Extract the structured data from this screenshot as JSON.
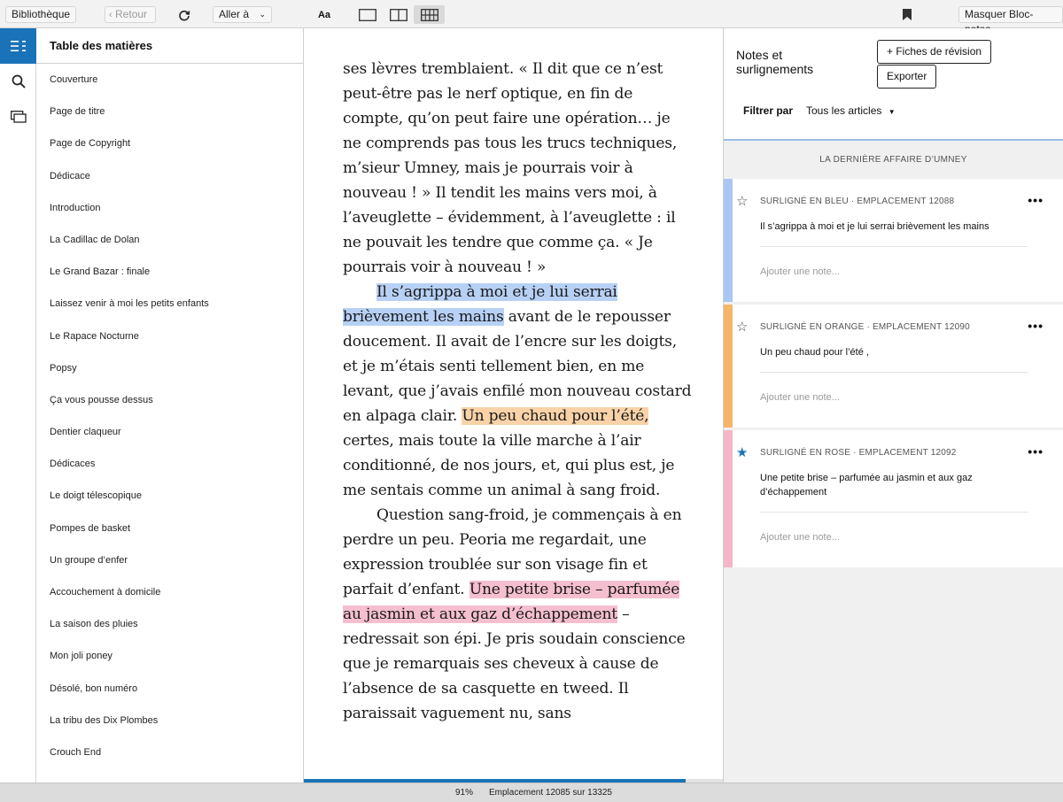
{
  "toolbar": {
    "library": "Bibliothèque",
    "back": "Retour",
    "goto": "Aller à",
    "font_button": "Aa",
    "hide_notebook": "Masquer Bloc-notes"
  },
  "toc": {
    "title": "Table des matières",
    "items": [
      "Couverture",
      "Page de titre",
      "Page de Copyright",
      "Dédicace",
      "Introduction",
      "La Cadillac de Dolan",
      "Le Grand Bazar : finale",
      "Laissez venir à moi les petits enfants",
      "Le Rapace Nocturne",
      "Popsy",
      "Ça vous pousse dessus",
      "Dentier claqueur",
      "Dédicaces",
      "Le doigt télescopique",
      "Pompes de basket",
      "Un groupe d’enfer",
      "Accouchement à domicile",
      "La saison des pluies",
      "Mon joli poney",
      "Désolé, bon numéro",
      "La tribu des Dix Plombes",
      "Crouch End"
    ]
  },
  "page": {
    "p1": "ses lèvres tremblaient. « Il dit que ce n’est peut-être pas le nerf optique, en fin de compte, qu’on peut faire une opération… je ne comprends pas tous les trucs tech­niques, m’sieur Umney, mais je pourrais voir à nouveau ! » Il tendit les mains vers moi, à l’aveuglette – évidemment, à l’aveu­glette : il ne pouvait les tendre que comme ça. « Je pourrais voir à nouveau ! »",
    "p2_hl_blue": "Il s’agrippa à moi et je lui serrai brièvement les mains",
    "p2_mid": " avant de le repous­ser doucement. Il avait de l’encre sur les doigts, et je m’étais senti tellement bien, en me levant, que j’avais enfilé mon nouveau costard en alpaga clair. ",
    "p2_hl_orange": "Un peu chaud pour l’été,",
    "p2_end": " certes, mais toute la ville marche à l’air conditionné, de nos jours, et, qui plus est, je me sentais comme un animal à sang froid.",
    "p3_start": "Question sang-froid, je commençais à en perdre un peu. Peoria me regardait, une expression troublée sur son visage fin et parfait d’enfant. ",
    "p3_hl_pink": "Une petite brise – parfumée au jasmin et aux gaz d’échappe­ment",
    "p3_end": " – redressait son épi. Je pris soudain conscience que je remarquais ses cheveux à cause de l’absence de sa casquette en tweed. Il paraissait vaguement nu, sans"
  },
  "notes": {
    "title": "Notes et surlignements",
    "flashcards_button": "+ Fiches de révision",
    "export_button": "Exporter",
    "filter_label": "Filtrer par",
    "filter_value": "Tous les articles",
    "book_title": "LA DERNIÈRE AFFAIRE D’UMNEY",
    "cards": [
      {
        "meta": "SURLIGNÉ EN BLEU · EMPLACEMENT 12088",
        "text": "Il s’agrippa à moi et je lui serrai brièvement les mains",
        "note_placeholder": "Ajouter une note...",
        "color": "#a9c7f2",
        "starred": false
      },
      {
        "meta": "SURLIGNÉ EN ORANGE · EMPLACEMENT 12090",
        "text": "Un peu chaud pour l’été ,",
        "note_placeholder": "Ajouter une note...",
        "color": "#f5b66a",
        "starred": false
      },
      {
        "meta": "SURLIGNÉ EN ROSE · EMPLACEMENT 12092",
        "text": "Une petite brise – parfumée au jasmin et aux gaz d’échappement",
        "note_placeholder": "Ajouter une note...",
        "color": "#f4b6c8",
        "starred": true
      }
    ]
  },
  "status": {
    "percent": "91%",
    "location": "Emplacement 12085 sur 13325",
    "progress_fraction": 0.91
  },
  "colors": {
    "accent": "#1a73b8",
    "highlight_blue": "#b7d1f5",
    "highlight_orange": "#f9d2a8",
    "highlight_pink": "#f5bfd0"
  },
  "icons": {
    "sync": "sync-icon",
    "bookmark": "bookmark-icon",
    "toc": "toc-icon",
    "search": "search-icon",
    "flashcards": "flashcards-icon",
    "star": "star-icon",
    "more": "more-icon"
  }
}
